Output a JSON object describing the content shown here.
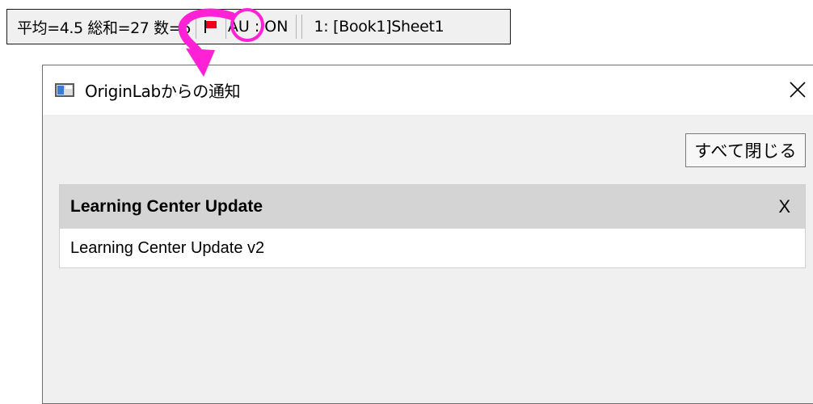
{
  "statusbar": {
    "stats": "平均=4.5 総和=27 数=6",
    "au": "AU : ON",
    "sheet": "1: [Book1]Sheet1"
  },
  "dialog": {
    "title": "OriginLabからの通知",
    "close_all_label": "すべて閉じる",
    "notifications": [
      {
        "title": "Learning Center Update",
        "close_label": "X",
        "body": "Learning Center Update v2"
      }
    ]
  },
  "annotation": {
    "color": "#ff21d6"
  },
  "icons": [
    "flag-icon",
    "app-icon",
    "close-icon"
  ]
}
